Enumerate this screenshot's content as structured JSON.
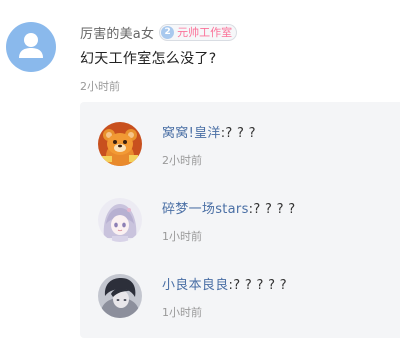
{
  "post": {
    "author": "厉害的美a女",
    "badge_number": "2",
    "badge_label": "元帅工作室",
    "content": "幻天工作室怎么没了?",
    "time": "2小时前",
    "avatar_icon": "default-user-icon"
  },
  "replies": [
    {
      "author": "窝窝!皇洋",
      "separator": ":",
      "text": "? ? ?",
      "time": "2小时前",
      "avatar_icon": "orange-bear-avatar"
    },
    {
      "author": "碎梦一场stars",
      "separator": ":",
      "text": "? ? ? ?",
      "time": "1小时前",
      "avatar_icon": "anime-girl-avatar"
    },
    {
      "author": "小良本良良",
      "separator": ":",
      "text": "? ? ? ? ?",
      "time": "1小时前",
      "avatar_icon": "dark-hair-avatar"
    }
  ],
  "colors": {
    "avatar_bg": "#8ab9ec",
    "badge_text": "#fb7299",
    "reply_panel_bg": "#f4f5f7",
    "meta_text": "#999999"
  }
}
